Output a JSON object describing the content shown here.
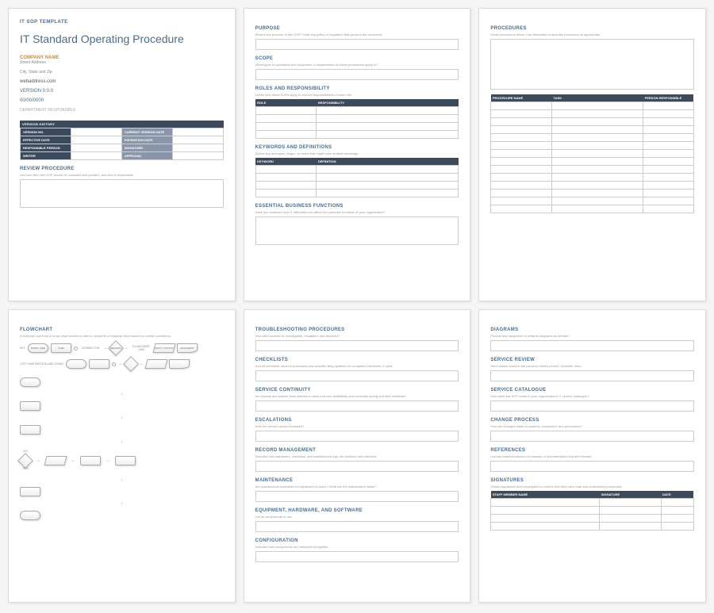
{
  "p1": {
    "header": "IT SOP TEMPLATE",
    "title": "IT Standard Operating Procedure",
    "company": "COMPANY NAME",
    "address1": "Street Address",
    "address2": "City, State and Zip",
    "web": "webaddress.com",
    "version": "VERSION 0.0.0",
    "date": "00/00/0000",
    "dept": "DEPARTMENT RESPONSIBLE",
    "vh": "VERSION HISTORY",
    "m": {
      "r1a": "VERSION NO.",
      "r1b": "CURRENT VERSION DATE",
      "r2a": "EFFECTIVE DATE",
      "r2b": "EXPIRATION DATE",
      "r3a": "RESPONSIBLE PERSON",
      "r3b": "SIGNATURE",
      "r4a": "WRITER",
      "r4b": "APPROVAL"
    },
    "review": "REVIEW PROCEDURE",
    "review_hint": "List how often this SOP should be reviewed and updated, and who is responsible."
  },
  "p2": {
    "purpose": "PURPOSE",
    "purpose_hint": "What is the purpose of this SOP? Note any policy or regulation that governs the document.",
    "scope": "SCOPE",
    "scope_hint": "What types of operations and equipment or departments do these procedures apply to?",
    "roles": "ROLES AND RESPONSIBILITY",
    "roles_hint": "Define who these SOPs apply to and the responsibilities of each role.",
    "th_role": "ROLE",
    "th_resp": "RESPONSIBILITY",
    "keywords": "KEYWORDS AND DEFINITIONS",
    "keywords_hint": "Define any acronyms, jargon, or terms that might have multiple meanings.",
    "th_kw": "KEYWORD",
    "th_def": "DEFINITION",
    "ebf": "ESSENTIAL BUSINESS FUNCTIONS",
    "ebf_hint": "Have you analyzed how IT difficulties can affect the particular functions of your organization?"
  },
  "p3": {
    "proc": "PROCEDURES",
    "proc_hint": "Detail procedures below. Use flowcharts to describe processes as appropriate.",
    "th_name": "PROCEDURE NAME",
    "th_task": "TASK",
    "th_person": "PERSON RESPONSIBLE"
  },
  "p4": {
    "flow": "FLOWCHART",
    "flow_hint": "A flowchart can help to show what actions to take to complete a helpdesk ticket based on certain conditions.",
    "key": "KEY",
    "start": "START / END",
    "step": "STEP",
    "connector": "CONNECTOR",
    "decision": "DECISION",
    "flowline": "FLOWCHART LINE",
    "io": "INPUT / OUTPUT",
    "document": "DOCUMENT",
    "copy": "COPY AND PASTE BLANK ICONS",
    "no": "NO",
    "yes": "YES"
  },
  "p5": {
    "trouble": "TROUBLESHOOTING PROCEDURES",
    "trouble_hint": "How will incidents be investigated, escalated, and resolved?",
    "check": "CHECKLISTS",
    "check_hint": "Add all checklists used for processes and describe filing systems for completed checklists, if used.",
    "svc": "SERVICE CONTINUITY",
    "svc_hint": "Are backup and restore tests defined to ensure service availability and continuity during and after incidents?",
    "esc": "ESCALATIONS",
    "esc_hint": "How are service issues escalated?",
    "rec": "RECORD MANAGEMENT",
    "rec_hint": "Describe how warranties, checklists, and maintenance logs are archived and retrieved.",
    "maint": "MAINTENANCE",
    "maint_hint": "Are maintenance schedules for equipment in place? What are the maintenance tasks?",
    "equip": "EQUIPMENT, HARDWARE, AND SOFTWARE",
    "equip_hint": "List all components in use.",
    "config": "CONFIGURATION",
    "config_hint": "Describe how components and networks fit together."
  },
  "p6": {
    "diag": "DIAGRAMS",
    "diag_hint": "Provide any equipment or network diagrams as needed.",
    "srev": "SERVICE REVIEW",
    "srev_hint": "Were issues found in the previous review period? Describe them.",
    "scat": "SERVICE CATALOGUE",
    "scat_hint": "How does this SOP relate to your organization's IT service catalogue?",
    "chg": "CHANGE PROCESS",
    "chg_hint": "How are changes made to systems, equipment, and procedures?",
    "ref": "REFERENCES",
    "ref_hint": "List any external sources of manuals or documentation that are relevant.",
    "sig": "SIGNATURES",
    "sig_hint": "Obtain signatures from employees to confirm that they have read and understand procedures.",
    "th_staff": "STAFF MEMBER NAME",
    "th_sig": "SIGNATURE",
    "th_date": "DATE"
  }
}
